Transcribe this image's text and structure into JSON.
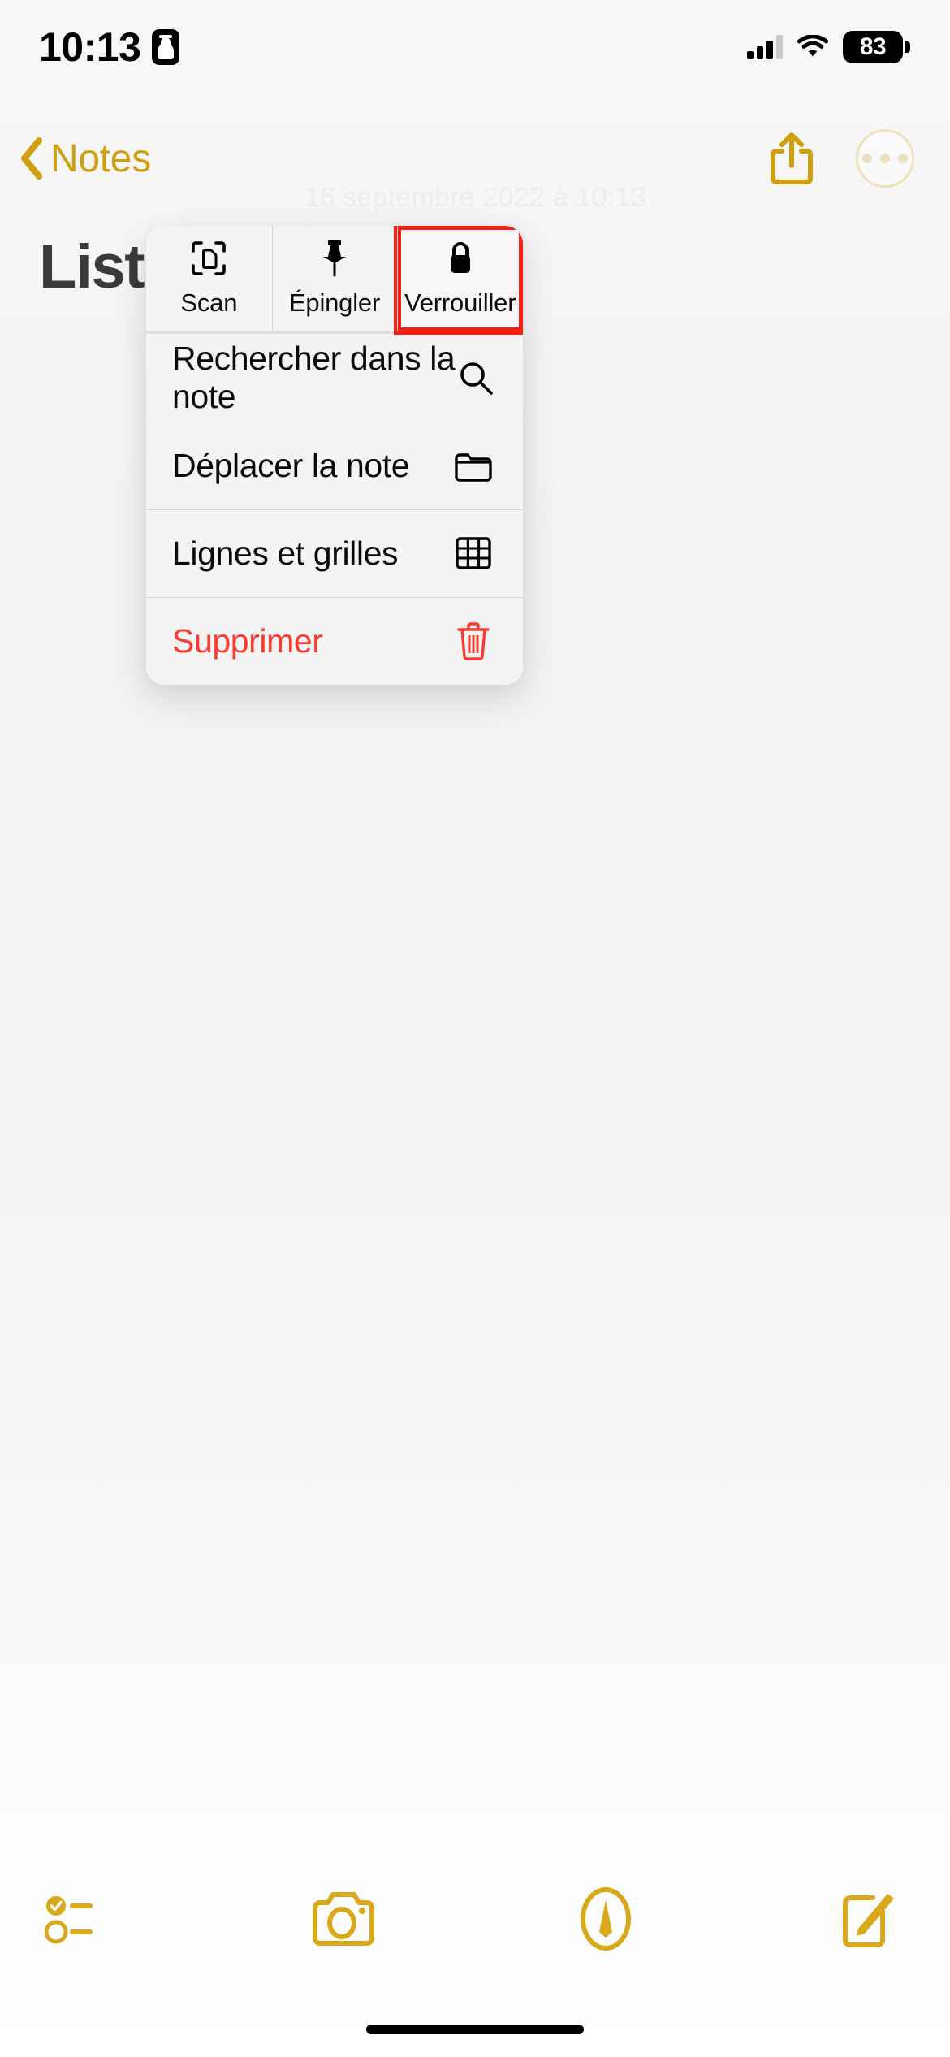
{
  "status_bar": {
    "time": "10:13",
    "recording_icon": "person-badge-icon",
    "signal_icon": "cellular-signal-icon",
    "signal_bars_active": 3,
    "signal_bars_total": 4,
    "wifi_icon": "wifi-icon",
    "battery_percent": "83"
  },
  "nav_bar": {
    "back_label": "Notes",
    "back_icon": "chevron-left-icon",
    "share_icon": "share-icon",
    "more_icon": "ellipsis-circle-icon",
    "accent_color": "#cf9e11"
  },
  "note": {
    "date": "16 septembre 2022 à 10:13",
    "title": "Liste d"
  },
  "context_menu": {
    "top_actions": [
      {
        "label": "Scan",
        "icon": "document-scan-icon",
        "highlighted": false
      },
      {
        "label": "Épingler",
        "icon": "pin-icon",
        "highlighted": false
      },
      {
        "label": "Verrouiller",
        "icon": "lock-icon",
        "highlighted": true
      }
    ],
    "highlight_color": "#f32013",
    "items": [
      {
        "label": "Rechercher dans la note",
        "icon": "search-icon",
        "destructive": false
      },
      {
        "label": "Déplacer la note",
        "icon": "folder-icon",
        "destructive": false
      },
      {
        "label": "Lignes et grilles",
        "icon": "grid-icon",
        "destructive": false
      },
      {
        "label": "Supprimer",
        "icon": "trash-icon",
        "destructive": true
      }
    ],
    "destructive_color": "#fc3b30"
  },
  "toolbar": {
    "items": [
      {
        "icon": "checklist-icon",
        "name": "checklist-button"
      },
      {
        "icon": "camera-icon",
        "name": "camera-button"
      },
      {
        "icon": "markup-pen-icon",
        "name": "markup-button"
      },
      {
        "icon": "compose-icon",
        "name": "compose-button"
      }
    ],
    "accent_color": "#d9a81b"
  }
}
